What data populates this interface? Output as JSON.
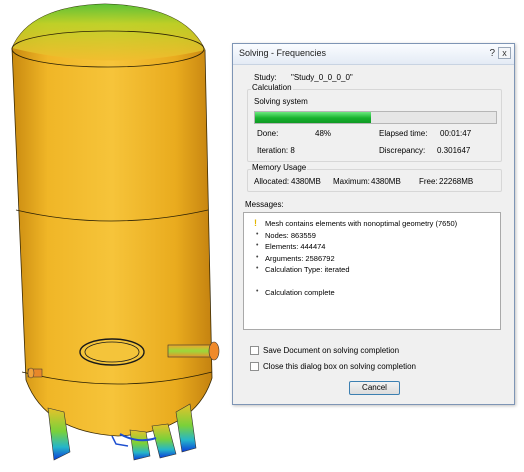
{
  "dialog": {
    "title": "Solving - Frequencies",
    "help_icon": "?",
    "close_icon": "x",
    "study_label": "Study:",
    "study_value": "\"Study_0_0_0_0\"",
    "calculation": {
      "group_label": "Calculation",
      "status": "Solving system",
      "progress_percent": 48,
      "done_label": "Done:",
      "done_value": "48%",
      "elapsed_label": "Elapsed time:",
      "elapsed_value": "00:01:47",
      "iteration_text": "Iteration: 8",
      "discrepancy_label": "Discrepancy:",
      "discrepancy_value": "0.301647"
    },
    "memory": {
      "group_label": "Memory Usage",
      "allocated_label": "Allocated:",
      "allocated_value": "4380MB",
      "maximum_label": "Maximum:",
      "maximum_value": "4380MB",
      "free_label": "Free:",
      "free_value": "22268MB"
    },
    "messages": {
      "label": "Messages:",
      "items": [
        {
          "icon": "warning",
          "text": "Mesh contains elements with nonoptimal geometry (7650)"
        },
        {
          "icon": "bullet",
          "text": "Nodes: 863559"
        },
        {
          "icon": "bullet",
          "text": "Elements: 444474"
        },
        {
          "icon": "bullet",
          "text": "Arguments: 2586792"
        },
        {
          "icon": "bullet",
          "text": "Calculation Type: iterated"
        },
        {
          "icon": "bullet",
          "text": "Calculation complete"
        }
      ]
    },
    "checkboxes": [
      {
        "label": "Save Document on solving completion",
        "checked": false
      },
      {
        "label": "Close this dialog box on solving completion",
        "checked": false
      }
    ],
    "cancel_label": "Cancel"
  },
  "colors": {
    "progress_fill": "#17b22e",
    "vessel_body": "#f2c02e",
    "vessel_shade": "#d99414",
    "stress_high": "#0050e0",
    "stress_mid": "#30c030"
  }
}
